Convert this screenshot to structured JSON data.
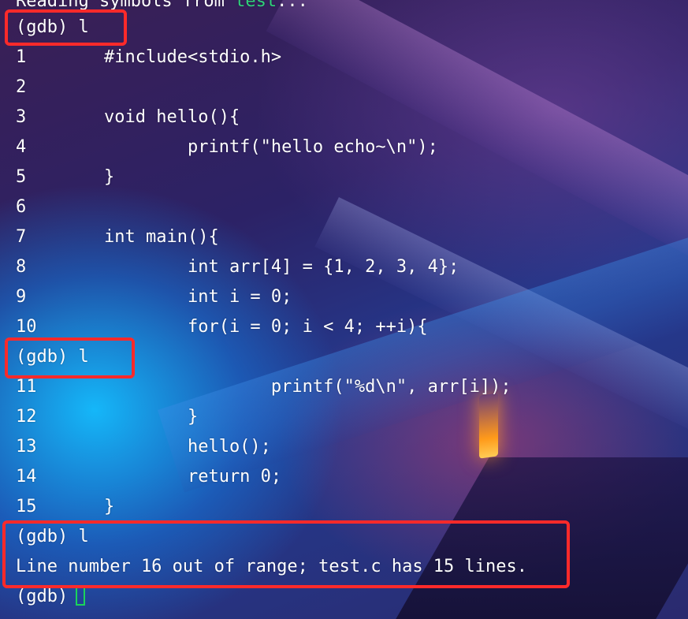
{
  "terminal": {
    "header_prefix": "Reading symbols from ",
    "header_file": "test",
    "header_suffix": "...",
    "prompt_1": "(gdb) l",
    "listing": [
      {
        "num": "1",
        "code": "#include<stdio.h>"
      },
      {
        "num": "2",
        "code": ""
      },
      {
        "num": "3",
        "code": "void hello(){"
      },
      {
        "num": "4",
        "code": "        printf(\"hello echo~\\n\");"
      },
      {
        "num": "5",
        "code": "}"
      },
      {
        "num": "6",
        "code": ""
      },
      {
        "num": "7",
        "code": "int main(){"
      },
      {
        "num": "8",
        "code": "        int arr[4] = {1, 2, 3, 4};"
      },
      {
        "num": "9",
        "code": "        int i = 0;"
      },
      {
        "num": "10",
        "code": "        for(i = 0; i < 4; ++i){"
      },
      {
        "num": "11",
        "code": "                printf(\"%d\\n\", arr[i]);"
      },
      {
        "num": "12",
        "code": "        }"
      },
      {
        "num": "13",
        "code": "        hello();"
      },
      {
        "num": "14",
        "code": "        return 0;"
      },
      {
        "num": "15",
        "code": "}"
      }
    ],
    "prompt_2": "(gdb) l",
    "prompt_3": "(gdb) l",
    "error_message": "Line number 16 out of range; test.c has 15 lines.",
    "prompt_final": "(gdb)"
  },
  "colors": {
    "text": "#ffffff",
    "filename": "#2fd27a",
    "highlight_box": "#ff2a2a",
    "cursor": "#1bd35b"
  }
}
